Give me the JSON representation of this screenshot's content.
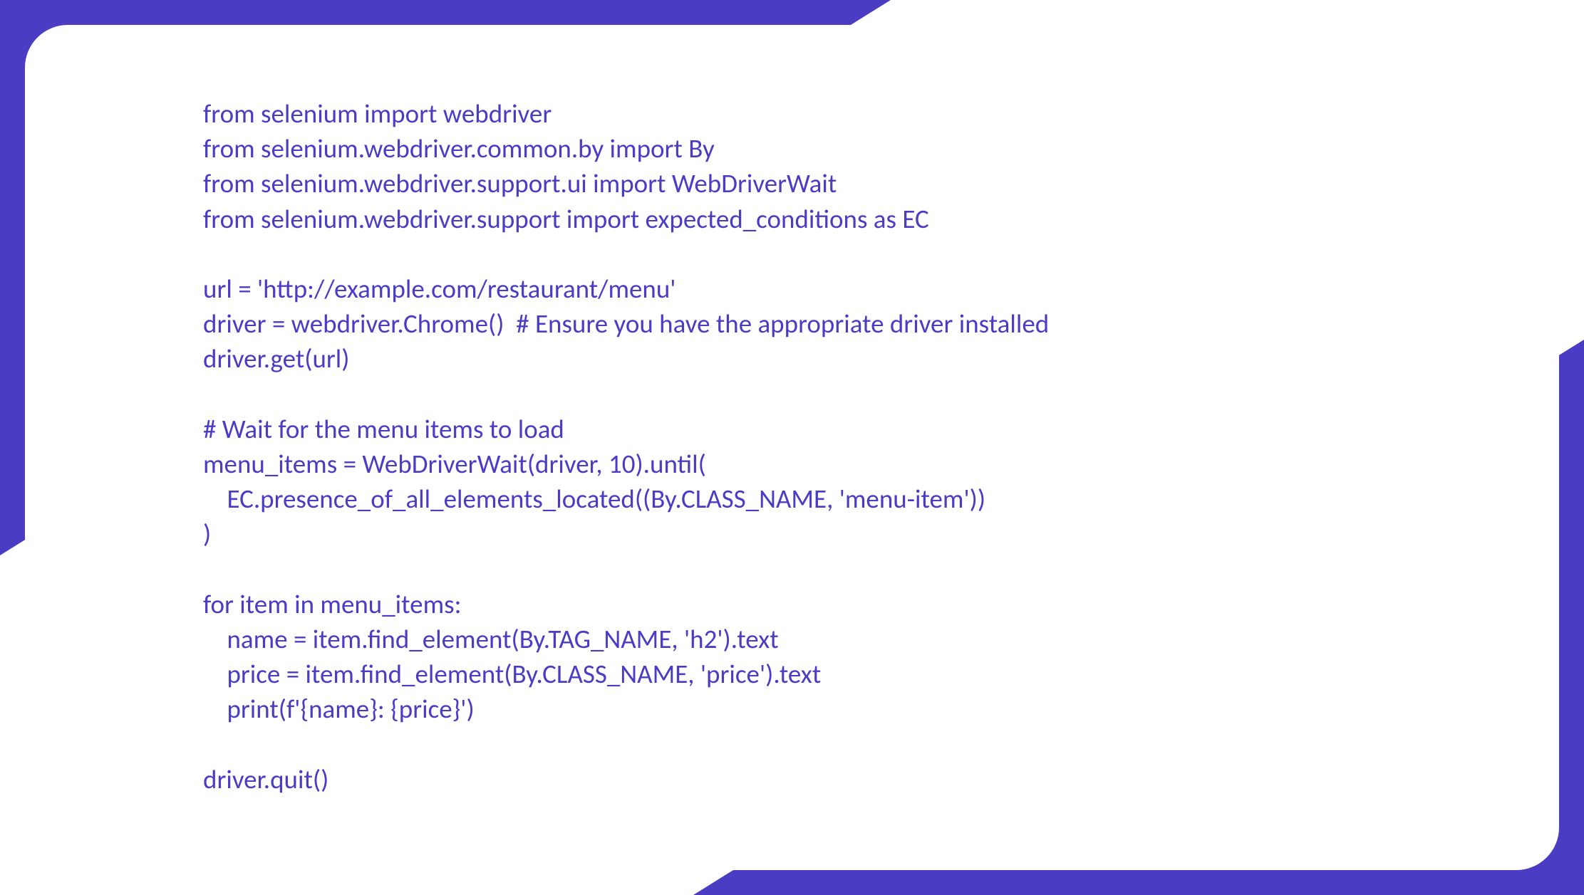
{
  "code": {
    "lines": [
      "from selenium import webdriver",
      "from selenium.webdriver.common.by import By",
      "from selenium.webdriver.support.ui import WebDriverWait",
      "from selenium.webdriver.support import expected_conditions as EC",
      "",
      "url = 'http://example.com/restaurant/menu'",
      "driver = webdriver.Chrome()  # Ensure you have the appropriate driver installed",
      "driver.get(url)",
      "",
      "# Wait for the menu items to load",
      "menu_items = WebDriverWait(driver, 10).until(",
      "    EC.presence_of_all_elements_located((By.CLASS_NAME, 'menu-item'))",
      ")",
      "",
      "for item in menu_items:",
      "    name = item.find_element(By.TAG_NAME, 'h2').text",
      "    price = item.find_element(By.CLASS_NAME, 'price').text",
      "    print(f'{name}: {price}')",
      "",
      "driver.quit()"
    ]
  }
}
